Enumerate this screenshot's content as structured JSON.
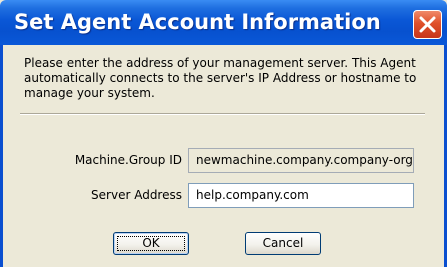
{
  "window": {
    "title": "Set Agent Account Information",
    "close_icon": "close-icon"
  },
  "description": "Please enter the address of your management server. This Agent automatically connects to the server's IP Address or hostname to manage your system.",
  "form": {
    "machine_group_label": "Machine.Group ID",
    "machine_group_value": "newmachine.company.company-org",
    "server_address_label": "Server Address",
    "server_address_value": "help.company.com"
  },
  "buttons": {
    "ok_label": "OK",
    "cancel_label": "Cancel"
  },
  "colors": {
    "titlebar": "#0a57d6",
    "close_button": "#e0512b",
    "dialog_background": "#ece9d8"
  }
}
